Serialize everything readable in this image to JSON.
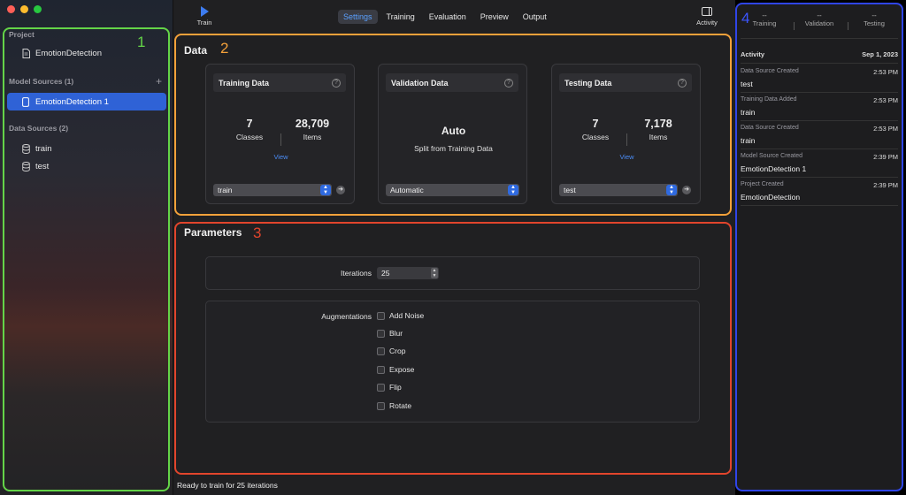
{
  "sidebar": {
    "project_heading": "Project",
    "project_name": "EmotionDetection",
    "model_sources_heading": "Model Sources (1)",
    "model_sources": [
      {
        "label": "EmotionDetection 1",
        "selected": true
      }
    ],
    "data_sources_heading": "Data Sources (2)",
    "data_sources": [
      {
        "label": "train"
      },
      {
        "label": "test"
      }
    ],
    "add_symbol": "+"
  },
  "annotations": {
    "one": "1",
    "two": "2",
    "three": "3",
    "four": "4"
  },
  "toolbar": {
    "train_label": "Train",
    "tabs": [
      {
        "label": "Settings",
        "active": true
      },
      {
        "label": "Training"
      },
      {
        "label": "Evaluation"
      },
      {
        "label": "Preview"
      },
      {
        "label": "Output"
      }
    ],
    "activity_label": "Activity"
  },
  "data_section": {
    "title": "Data",
    "cards": [
      {
        "title": "Training Data",
        "classes_value": "7",
        "classes_label": "Classes",
        "items_value": "28,709",
        "items_label": "Items",
        "view_label": "View",
        "select_value": "train"
      },
      {
        "title": "Validation Data",
        "main_value": "Auto",
        "sub_label": "Split from Training Data",
        "select_value": "Automatic"
      },
      {
        "title": "Testing Data",
        "classes_value": "7",
        "classes_label": "Classes",
        "items_value": "7,178",
        "items_label": "Items",
        "view_label": "View",
        "select_value": "test"
      }
    ],
    "help_symbol": "?"
  },
  "parameters": {
    "title": "Parameters",
    "iterations_label": "Iterations",
    "iterations_value": "25",
    "augmentations_label": "Augmentations",
    "augmentations": [
      {
        "label": "Add Noise",
        "checked": false
      },
      {
        "label": "Blur",
        "checked": false
      },
      {
        "label": "Crop",
        "checked": false
      },
      {
        "label": "Expose",
        "checked": false
      },
      {
        "label": "Flip",
        "checked": false
      },
      {
        "label": "Rotate",
        "checked": false
      }
    ]
  },
  "status": {
    "text": "Ready to train for 25 iterations"
  },
  "inspector": {
    "metrics": [
      {
        "value": "--",
        "label": "Training"
      },
      {
        "value": "--",
        "label": "Validation"
      },
      {
        "value": "--",
        "label": "Testing"
      }
    ],
    "activity_heading": "Activity",
    "activity_date": "Sep 1, 2023",
    "items": [
      {
        "type": "Data Source Created",
        "time": "2:53 PM",
        "name": "test"
      },
      {
        "type": "Training Data Added",
        "time": "2:53 PM",
        "name": "train"
      },
      {
        "type": "Data Source Created",
        "time": "2:53 PM",
        "name": "train"
      },
      {
        "type": "Model Source Created",
        "time": "2:39 PM",
        "name": "EmotionDetection 1"
      },
      {
        "type": "Project Created",
        "time": "2:39 PM",
        "name": "EmotionDetection"
      }
    ]
  },
  "colors": {
    "accent": "#2f62d6",
    "link": "#4a8cf5",
    "frame_green": "#64d448",
    "frame_orange": "#f4a13a",
    "frame_red": "#e2452c",
    "frame_blue": "#2f45e8"
  }
}
